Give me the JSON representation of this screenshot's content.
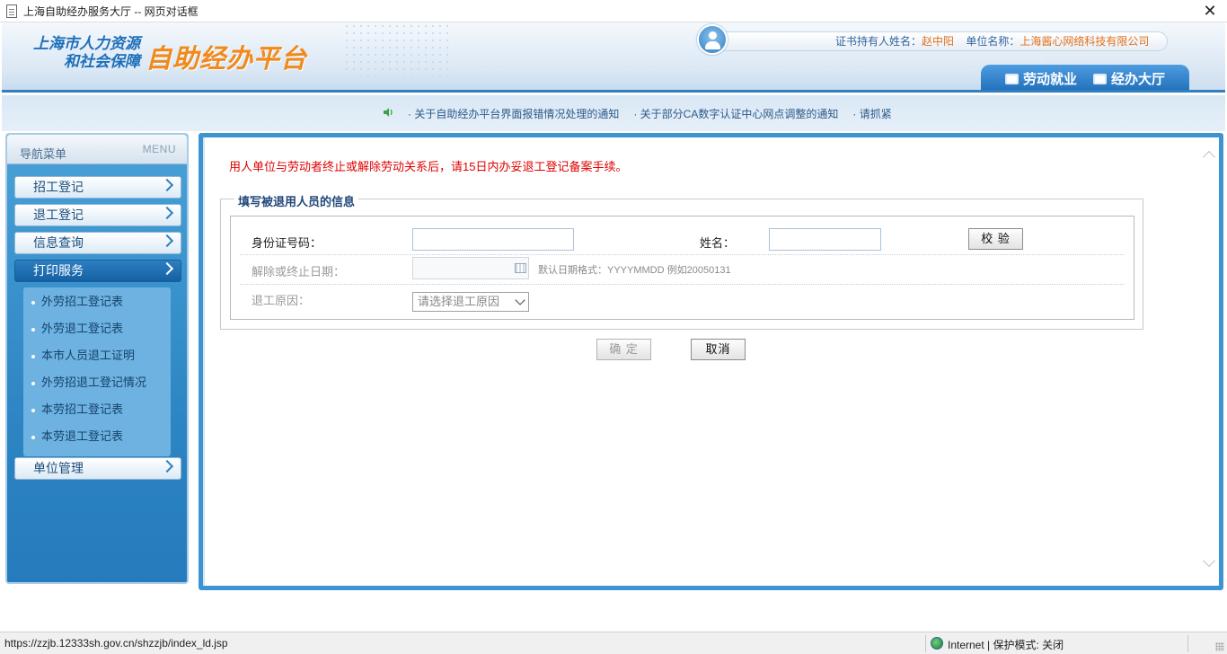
{
  "window": {
    "title": "上海自助经办服务大厅 -- 网页对话框"
  },
  "header": {
    "logo_line1": "上海市人力资源",
    "logo_line2": "和社会保障",
    "logo_main": "自助经办平台",
    "holder_label": "证书持有人姓名：",
    "holder_name": "赵中阳",
    "unit_label": "单位名称：",
    "unit_name": "上海酱心网络科技有限公司",
    "tabs": [
      {
        "label": "劳动就业"
      },
      {
        "label": "经办大厅"
      }
    ]
  },
  "notices": [
    "· 关于自助经办平台界面报错情况处理的通知",
    "· 关于部分CA数字认证中心网点调整的通知",
    "· 请抓紧"
  ],
  "sidebar": {
    "title": "导航菜单",
    "title_en": "MENU",
    "items": [
      {
        "label": "招工登记"
      },
      {
        "label": "退工登记"
      },
      {
        "label": "信息查询"
      },
      {
        "label": "打印服务"
      },
      {
        "label": "单位管理"
      }
    ],
    "active_index": 3,
    "subitems": [
      {
        "label": "外劳招工登记表"
      },
      {
        "label": "外劳退工登记表"
      },
      {
        "label": "本市人员退工证明"
      },
      {
        "label": "外劳招退工登记情况"
      },
      {
        "label": "本劳招工登记表"
      },
      {
        "label": "本劳退工登记表"
      }
    ]
  },
  "main": {
    "warning": "用人单位与劳动者终止或解除劳动关系后，请15日内办妥退工登记备案手续。",
    "section_title": "填写被退用人员的信息",
    "form": {
      "id_label": "身份证号码：",
      "id_value": "",
      "name_label": "姓名：",
      "name_value": "",
      "verify_button": "校 验",
      "date_label": "解除或终止日期：",
      "date_value": "",
      "date_hint": "默认日期格式：YYYYMMDD 例如20050131",
      "reason_label": "退工原因：",
      "reason_selected": "请选择退工原因",
      "confirm_button": "确 定",
      "cancel_button": "取消"
    }
  },
  "statusbar": {
    "url": "https://zzjb.12333sh.gov.cn/shzzjb/index_ld.jsp",
    "zone": "Internet | 保护模式: 关闭"
  }
}
